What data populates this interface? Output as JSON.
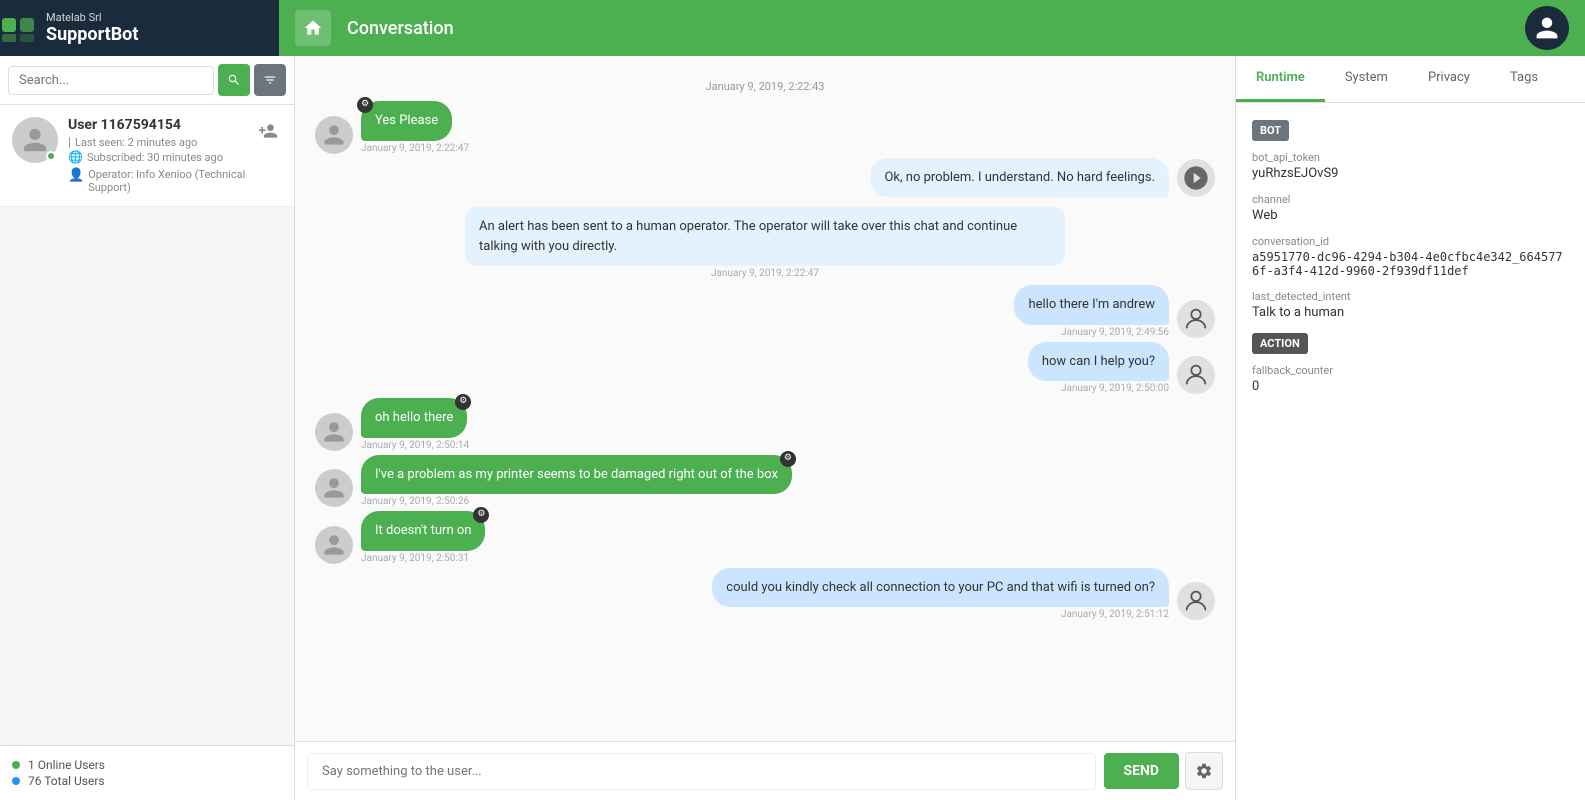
{
  "brand": {
    "company": "Matelab Srl",
    "app_name": "SupportBot"
  },
  "header": {
    "title": "Conversation"
  },
  "search": {
    "placeholder": "Search..."
  },
  "user": {
    "name": "User 1167594154",
    "last_seen": "Last seen: 2 minutes ago",
    "subscribed": "Subscribed: 30 minutes ago",
    "operator": "Operator: Info Xenioo (Technical Support)"
  },
  "sidebar_stats": {
    "online": "1 Online Users",
    "total": "76 Total Users"
  },
  "messages": [
    {
      "id": "ts1",
      "type": "timestamp",
      "text": "January 9, 2019, 2:22:43"
    },
    {
      "id": "m1",
      "type": "user",
      "text": "Yes Please",
      "time": "January 9, 2019, 2:22:47"
    },
    {
      "id": "m2",
      "type": "bot-right",
      "text": "Ok, no problem. I understand. No hard feelings.",
      "time": ""
    },
    {
      "id": "m3",
      "type": "bot-center",
      "text": "An alert has been sent to a human operator. The operator will take over this chat and continue talking with you directly.",
      "time": "January 9, 2019, 2:22:47"
    },
    {
      "id": "m4",
      "type": "operator-right",
      "text": "hello there I'm andrew",
      "time": "January 9, 2019, 2:49:56"
    },
    {
      "id": "m5",
      "type": "operator-right",
      "text": "how can I help you?",
      "time": "January 9, 2019, 2:50:00"
    },
    {
      "id": "m6",
      "type": "user",
      "text": "oh hello there",
      "time": "January 9, 2019, 2:50:14"
    },
    {
      "id": "m7",
      "type": "user",
      "text": "I've a problem as my printer seems to be damaged right out of the box",
      "time": "January 9, 2019, 2:50:26"
    },
    {
      "id": "m8",
      "type": "user",
      "text": "It doesn't turn on",
      "time": "January 9, 2019, 2:50:31"
    },
    {
      "id": "m9",
      "type": "operator-right",
      "text": "could you kindly check all connection to your PC and that wifi is turned on?",
      "time": "January 9, 2019, 2:51:12"
    }
  ],
  "chat_input": {
    "placeholder": "Say something to the user...",
    "send_label": "SEND"
  },
  "right_panel": {
    "tabs": [
      "Runtime",
      "System",
      "Privacy",
      "Tags"
    ],
    "active_tab": "Runtime",
    "bot_section": "BOT",
    "bot_api_token_label": "bot_api_token",
    "bot_api_token_value": "yuRhzsEJOvS9",
    "channel_label": "channel",
    "channel_value": "Web",
    "conversation_id_label": "conversation_id",
    "conversation_id_value": "a5951770-dc96-4294-b304-4e0cfbc4e342_6645776f-a3f4-412d-9960-2f939df11def",
    "last_detected_intent_label": "last_detected_intent",
    "last_detected_intent_value": "Talk to a human",
    "action_section": "ACTION",
    "fallback_counter_label": "fallback_counter",
    "fallback_counter_value": "0"
  }
}
